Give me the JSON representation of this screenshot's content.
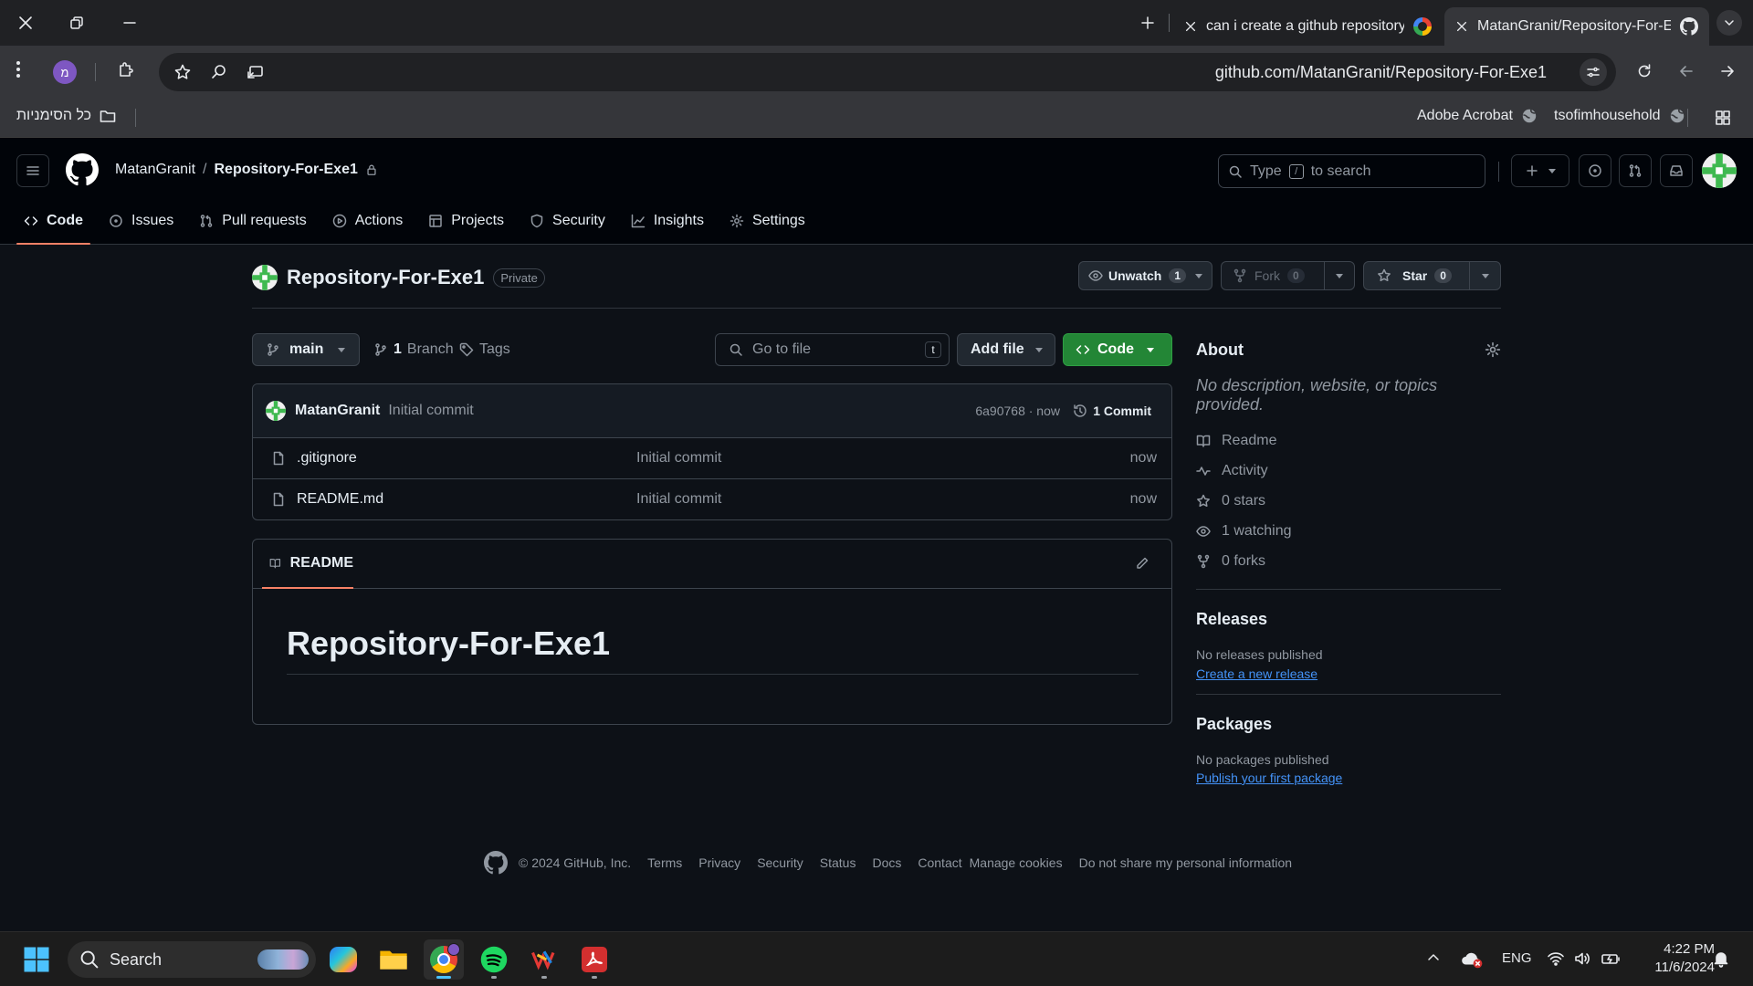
{
  "browser": {
    "tabs": [
      {
        "title": "can i create a github repository",
        "active": false
      },
      {
        "title": "MatanGranit/Repository-For-Exe1",
        "active": true
      }
    ],
    "url": "github.com/MatanGranit/Repository-For-Exe1",
    "profile_initial": "מ",
    "bookmarks": {
      "all_bookmarks": "כל הסימניות",
      "items": [
        "Adobe Acrobat",
        "tsofimhousehold"
      ]
    }
  },
  "github": {
    "owner": "MatanGranit",
    "repo": "Repository-For-Exe1",
    "search_placeholder_prefix": "Type",
    "search_key": "/",
    "search_placeholder_suffix": "to search",
    "nav": [
      {
        "label": "Code",
        "icon": "code-icon",
        "selected": true
      },
      {
        "label": "Issues",
        "icon": "issue-icon"
      },
      {
        "label": "Pull requests",
        "icon": "pull-request-icon"
      },
      {
        "label": "Actions",
        "icon": "play-icon"
      },
      {
        "label": "Projects",
        "icon": "table-icon"
      },
      {
        "label": "Security",
        "icon": "shield-icon"
      },
      {
        "label": "Insights",
        "icon": "graph-icon"
      },
      {
        "label": "Settings",
        "icon": "gear-icon"
      }
    ],
    "visibility": "Private",
    "watch": {
      "label": "Unwatch",
      "count": "1"
    },
    "fork": {
      "label": "Fork",
      "count": "0"
    },
    "star": {
      "label": "Star",
      "count": "0"
    },
    "branch": "main",
    "branch_count": "1",
    "branch_label": "Branch",
    "tags_label": "Tags",
    "goto_placeholder": "Go to file",
    "goto_key": "t",
    "add_file": "Add file",
    "code_btn": "Code",
    "commit": {
      "author": "MatanGranit",
      "message": "Initial commit",
      "sha": "6a90768 · now",
      "count_label": "1 Commit"
    },
    "files": [
      {
        "name": ".gitignore",
        "message": "Initial commit",
        "time": "now"
      },
      {
        "name": "README.md",
        "message": "Initial commit",
        "time": "now"
      }
    ],
    "readme": {
      "tab": "README",
      "heading": "Repository-For-Exe1"
    },
    "about": {
      "title": "About",
      "description": "No description, website, or topics provided.",
      "items": [
        {
          "label": "Readme",
          "icon": "book-icon"
        },
        {
          "label": "Activity",
          "icon": "pulse-icon"
        },
        {
          "label": "0 stars",
          "icon": "star-icon"
        },
        {
          "label": "1 watching",
          "icon": "eye-icon"
        },
        {
          "label": "0 forks",
          "icon": "fork-icon"
        }
      ]
    },
    "releases": {
      "title": "Releases",
      "none": "No releases published",
      "link": "Create a new release"
    },
    "packages": {
      "title": "Packages",
      "none": "No packages published",
      "link": "Publish your first package"
    },
    "footer": {
      "copyright": "© 2024 GitHub, Inc.",
      "links": [
        "Terms",
        "Privacy",
        "Security",
        "Status",
        "Docs",
        "Contact",
        "Manage cookies",
        "Do not share my personal information"
      ]
    }
  },
  "taskbar": {
    "search": "Search",
    "lang": "ENG",
    "time": "4:22 PM",
    "date": "11/6/2024"
  },
  "colors": {
    "accent_green": "#238636",
    "link_blue": "#4493f8",
    "tab_underline": "#f78166"
  }
}
